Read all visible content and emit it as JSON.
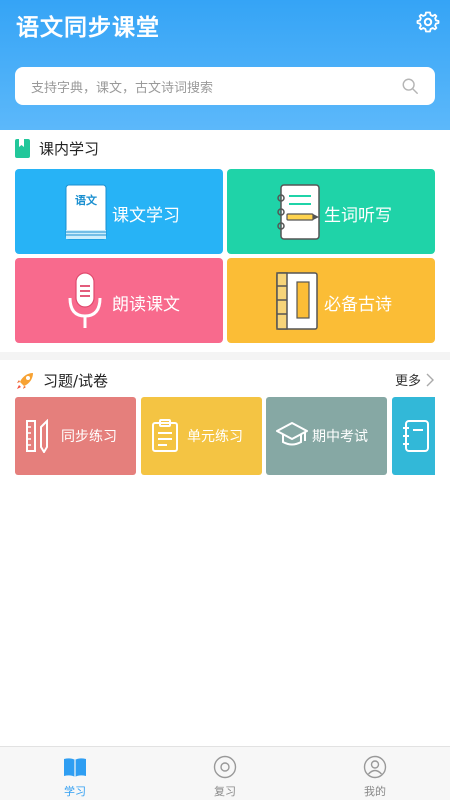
{
  "app": {
    "title": "语文同步课堂"
  },
  "search": {
    "placeholder": "支持字典，课文，古文诗词搜索"
  },
  "section_in_class": {
    "title": "课内学习",
    "tiles": [
      {
        "label": "课文学习",
        "color": "#27b3f6",
        "icon": "textbook-icon",
        "icon_text": "语文"
      },
      {
        "label": "生词听写",
        "color": "#1fd3a8",
        "icon": "notebook-pen-icon"
      },
      {
        "label": "朗读课文",
        "color": "#f86a8d",
        "icon": "microphone-icon"
      },
      {
        "label": "必备古诗",
        "color": "#fbbd36",
        "icon": "ancient-book-icon"
      }
    ]
  },
  "section_exercises": {
    "title": "习题/试卷",
    "more_label": "更多",
    "items": [
      {
        "label": "同步练习",
        "color": "#e57f7c",
        "icon": "pencil-ruler-icon"
      },
      {
        "label": "单元练习",
        "color": "#f4c443",
        "icon": "clipboard-icon"
      },
      {
        "label": "期中考试",
        "color": "#86a8a4",
        "icon": "graduation-cap-icon"
      },
      {
        "label": "",
        "color": "#32b8d8",
        "icon": "notebook-icon"
      }
    ]
  },
  "bottom_nav": [
    {
      "label": "学习",
      "icon": "open-book-icon",
      "active": true
    },
    {
      "label": "复习",
      "icon": "target-icon",
      "active": false
    },
    {
      "label": "我的",
      "icon": "profile-icon",
      "active": false
    }
  ],
  "colors": {
    "accent": "#2f9ef2",
    "header": "#35a4f6"
  }
}
